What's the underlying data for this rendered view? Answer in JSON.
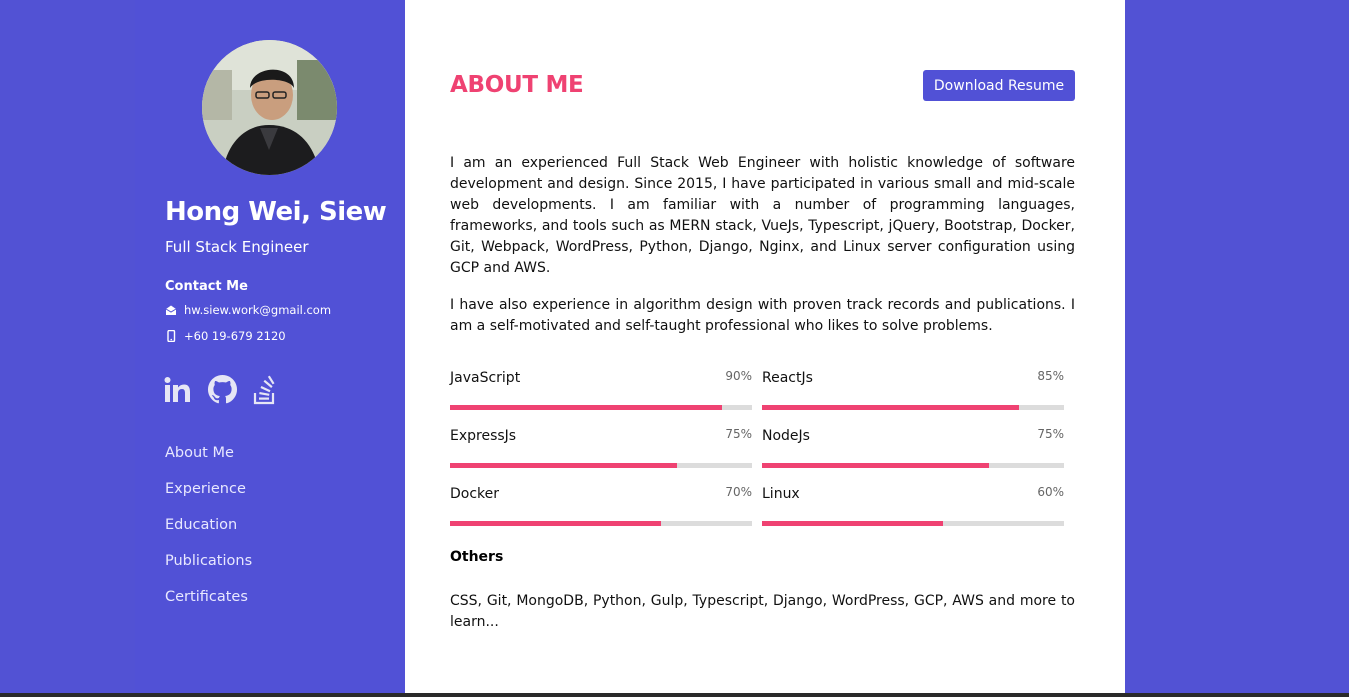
{
  "profile": {
    "name": "Hong Wei, Siew",
    "role": "Full Stack Engineer",
    "contact_title": "Contact Me",
    "email": "hw.siew.work@gmail.com",
    "phone": "+60 19-679 2120"
  },
  "socials": [
    {
      "name": "linkedin",
      "icon": "linkedin-icon"
    },
    {
      "name": "github",
      "icon": "github-icon"
    },
    {
      "name": "stackoverflow",
      "icon": "stackoverflow-icon"
    }
  ],
  "nav": [
    "About Me",
    "Experience",
    "Education",
    "Publications",
    "Certificates"
  ],
  "main": {
    "title": "ABOUT ME",
    "download_label": "Download Resume",
    "paragraphs": [
      "I am an experienced Full Stack Web Engineer with holistic knowledge of software development and design. Since 2015, I have participated in various small and mid-scale web developments. I am familiar with a number of programming languages, frameworks, and tools such as MERN stack, VueJs, Typescript, jQuery, Bootstrap, Docker, Git, Webpack, WordPress, Python, Django, Nginx, and Linux server configuration using GCP and AWS.",
      "I have also experience in algorithm design with proven track records and publications. I am a self-motivated and self-taught professional who likes to solve problems."
    ],
    "skills": [
      {
        "name": "JavaScript",
        "percent": "90%",
        "value": 0.9
      },
      {
        "name": "ReactJs",
        "percent": "85%",
        "value": 0.85
      },
      {
        "name": "ExpressJs",
        "percent": "75%",
        "value": 0.75
      },
      {
        "name": "NodeJs",
        "percent": "75%",
        "value": 0.75
      },
      {
        "name": "Docker",
        "percent": "70%",
        "value": 0.7
      },
      {
        "name": "Linux",
        "percent": "60%",
        "value": 0.6
      }
    ],
    "others_title": "Others",
    "others_text": "CSS, Git, MongoDB, Python, Gulp, Typescript, Django, WordPress, GCP, AWS and more to learn..."
  },
  "colors": {
    "accent": "#ef4272",
    "brand": "#5151d6",
    "bar_track": "#dcdcdc"
  }
}
